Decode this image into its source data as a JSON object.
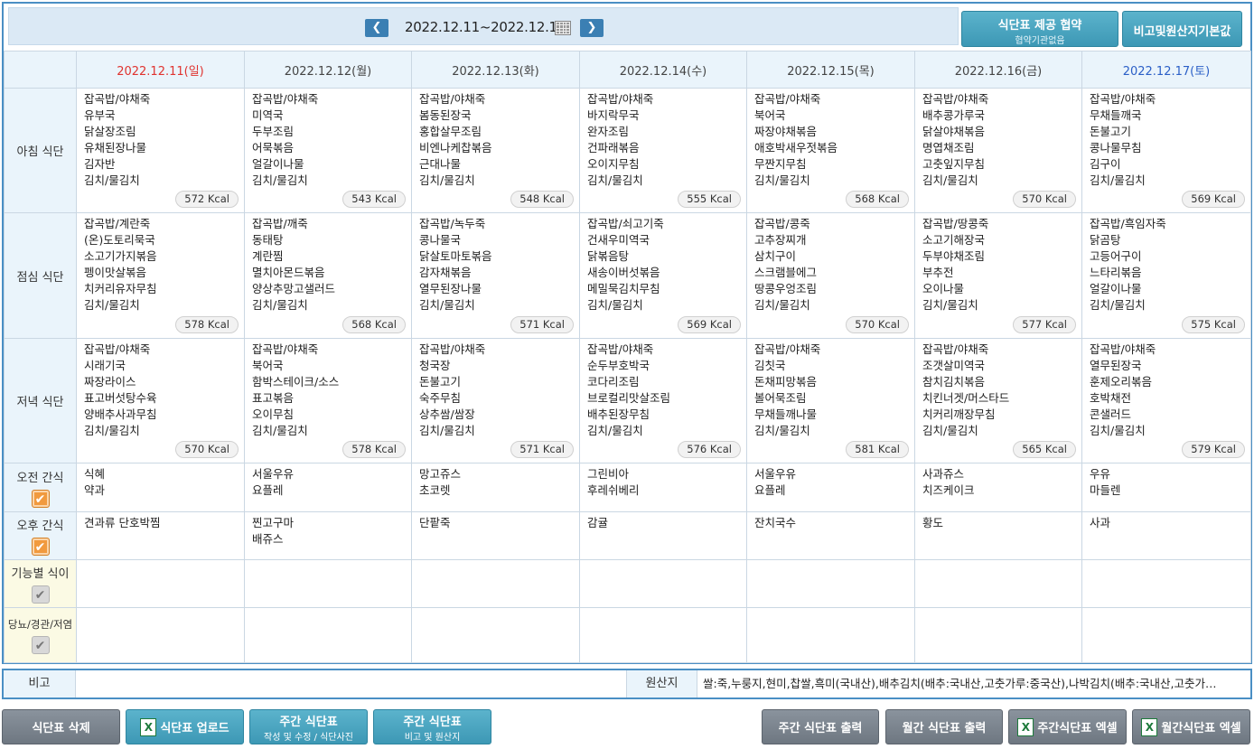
{
  "header": {
    "date_range": "2022.12.11~2022.12.17",
    "prev_icon": "chevron-left-icon",
    "next_icon": "chevron-right-icon",
    "provide_btn": {
      "main": "식단표 제공 협약",
      "sub": "협약기관없음"
    },
    "origin_default_btn": "비고및원산지기본값"
  },
  "days": [
    {
      "label": "2022.12.11(일)",
      "type": "sun"
    },
    {
      "label": "2022.12.12(월)",
      "type": ""
    },
    {
      "label": "2022.12.13(화)",
      "type": ""
    },
    {
      "label": "2022.12.14(수)",
      "type": ""
    },
    {
      "label": "2022.12.15(목)",
      "type": ""
    },
    {
      "label": "2022.12.16(금)",
      "type": ""
    },
    {
      "label": "2022.12.17(토)",
      "type": "sat"
    }
  ],
  "rows": [
    {
      "label": "아침 식단",
      "type": "meal",
      "cells": [
        {
          "items": [
            "잡곡밥/야채죽",
            "유부국",
            "닭살장조림",
            "유채된장나물",
            "김자반",
            "김치/물김치"
          ],
          "kcal": "572 Kcal"
        },
        {
          "items": [
            "잡곡밥/야채죽",
            "미역국",
            "두부조림",
            "어묵볶음",
            "얼갈이나물",
            "김치/물김치"
          ],
          "kcal": "543 Kcal"
        },
        {
          "items": [
            "잡곡밥/야채죽",
            "봄동된장국",
            "홍합살무조림",
            "비엔나케찹볶음",
            "근대나물",
            "김치/물김치"
          ],
          "kcal": "548 Kcal"
        },
        {
          "items": [
            "잡곡밥/야채죽",
            "바지락무국",
            "완자조림",
            "건파래볶음",
            "오이지무침",
            "김치/물김치"
          ],
          "kcal": "555 Kcal"
        },
        {
          "items": [
            "잡곡밥/야채죽",
            "북어국",
            "짜장야채볶음",
            "애호박새우젓볶음",
            "무짠지무침",
            "김치/물김치"
          ],
          "kcal": "568 Kcal"
        },
        {
          "items": [
            "잡곡밥/야채죽",
            "배추콩가루국",
            "닭살야채볶음",
            "명엽채조림",
            "고춧잎지무침",
            "김치/물김치"
          ],
          "kcal": "570 Kcal"
        },
        {
          "items": [
            "잡곡밥/야채죽",
            "무채들깨국",
            "돈불고기",
            "콩나물무침",
            "김구이",
            "김치/물김치"
          ],
          "kcal": "569 Kcal"
        }
      ]
    },
    {
      "label": "점심 식단",
      "type": "meal",
      "cells": [
        {
          "items": [
            "잡곡밥/계란죽",
            "(온)도토리묵국",
            "소고기가지볶음",
            "펭이맛살볶음",
            "치커리유자무침",
            "김치/물김치"
          ],
          "kcal": "578 Kcal"
        },
        {
          "items": [
            "잡곡밥/깨죽",
            "동태탕",
            "계란찜",
            "멸치아몬드볶음",
            "양상추망고샐러드",
            "김치/물김치"
          ],
          "kcal": "568 Kcal"
        },
        {
          "items": [
            "잡곡밥/녹두죽",
            "콩나물국",
            "닭살토마토볶음",
            "감자채볶음",
            "열무된장나물",
            "김치/물김치"
          ],
          "kcal": "571 Kcal"
        },
        {
          "items": [
            "잡곡밥/쇠고기죽",
            "건새우미역국",
            "닭볶음탕",
            "새송이버섯볶음",
            "메밀묵김치무침",
            "김치/물김치"
          ],
          "kcal": "569 Kcal"
        },
        {
          "items": [
            "잡곡밥/콩죽",
            "고추장찌개",
            "삼치구이",
            "스크램블에그",
            "땅콩우엉조림",
            "김치/물김치"
          ],
          "kcal": "570 Kcal"
        },
        {
          "items": [
            "잡곡밥/땅콩죽",
            "소고기해장국",
            "두부야채조림",
            "부추전",
            "오이나물",
            "김치/물김치"
          ],
          "kcal": "577 Kcal"
        },
        {
          "items": [
            "잡곡밥/흑임자죽",
            "닭곰탕",
            "고등어구이",
            "느타리볶음",
            "얼갈이나물",
            "김치/물김치"
          ],
          "kcal": "575 Kcal"
        }
      ]
    },
    {
      "label": "저녁 식단",
      "type": "meal",
      "cells": [
        {
          "items": [
            "잡곡밥/야채죽",
            "시래기국",
            "짜장라이스",
            "표고버섯탕수육",
            "양배추사과무침",
            "김치/물김치"
          ],
          "kcal": "570 Kcal"
        },
        {
          "items": [
            "잡곡밥/야채죽",
            "북어국",
            "함박스테이크/소스",
            "표고볶음",
            "오이무침",
            "김치/물김치"
          ],
          "kcal": "578 Kcal"
        },
        {
          "items": [
            "잡곡밥/야채죽",
            "청국장",
            "돈불고기",
            "숙주무침",
            "상추쌈/쌈장",
            "김치/물김치"
          ],
          "kcal": "571 Kcal"
        },
        {
          "items": [
            "잡곡밥/야채죽",
            "순두부호박국",
            "코다리조림",
            "브로컬리맛살조림",
            "배추된장무침",
            "김치/물김치"
          ],
          "kcal": "576 Kcal"
        },
        {
          "items": [
            "잡곡밥/야채죽",
            "김칫국",
            "돈채피망볶음",
            "볼어묵조림",
            "무채들깨나물",
            "김치/물김치"
          ],
          "kcal": "581 Kcal"
        },
        {
          "items": [
            "잡곡밥/야채죽",
            "조갯살미역국",
            "참치김치볶음",
            "치킨너겟/머스타드",
            "치커리깨장무침",
            "김치/물김치"
          ],
          "kcal": "565 Kcal"
        },
        {
          "items": [
            "잡곡밥/야채죽",
            "열무된장국",
            "훈제오리볶음",
            "호박채전",
            "콘샐러드",
            "김치/물김치"
          ],
          "kcal": "579 Kcal"
        }
      ]
    },
    {
      "label": "오전 간식",
      "type": "snack",
      "check": "on",
      "cells": [
        {
          "items": [
            "식혜",
            "약과"
          ]
        },
        {
          "items": [
            "서울우유",
            "요플레"
          ]
        },
        {
          "items": [
            "망고쥬스",
            "초코렛"
          ]
        },
        {
          "items": [
            "그린비아",
            "후레쉬베리"
          ]
        },
        {
          "items": [
            "서울우유",
            "요플레"
          ]
        },
        {
          "items": [
            "사과쥬스",
            "치즈케이크"
          ]
        },
        {
          "items": [
            "우유",
            "마들렌"
          ]
        }
      ]
    },
    {
      "label": "오후 간식",
      "type": "snack",
      "check": "on",
      "cells": [
        {
          "items": [
            "견과류 단호박찜"
          ]
        },
        {
          "items": [
            "찐고구마",
            "배쥬스"
          ]
        },
        {
          "items": [
            "단팥죽"
          ]
        },
        {
          "items": [
            "감귤"
          ]
        },
        {
          "items": [
            "잔치국수"
          ]
        },
        {
          "items": [
            "황도"
          ]
        },
        {
          "items": [
            "사과"
          ]
        }
      ]
    },
    {
      "label": "기능별 식이",
      "type": "special",
      "check": "off",
      "cells": [
        {
          "items": []
        },
        {
          "items": []
        },
        {
          "items": []
        },
        {
          "items": []
        },
        {
          "items": []
        },
        {
          "items": []
        },
        {
          "items": []
        }
      ]
    },
    {
      "label": "당뇨/경관/저염",
      "type": "special",
      "check": "off",
      "cells": [
        {
          "items": []
        },
        {
          "items": []
        },
        {
          "items": []
        },
        {
          "items": []
        },
        {
          "items": []
        },
        {
          "items": []
        },
        {
          "items": []
        }
      ]
    }
  ],
  "remark": {
    "label": "비고",
    "value": "",
    "origin_label": "원산지",
    "origin_value": "쌀:죽,누룽지,현미,찹쌀,흑미(국내산),배추김치(배추:국내산,고춧가루:중국산),나박김치(배추:국내산,고춧가…"
  },
  "buttons": {
    "delete": "식단표 삭제",
    "upload": "식단표 업로드",
    "weekly_edit": {
      "main": "주간 식단표",
      "sub": "작성 및 수정 / 식단사진"
    },
    "weekly_origin": {
      "main": "주간 식단표",
      "sub": "비고 및 원산지"
    },
    "weekly_print": "주간 식단표 출력",
    "monthly_print": "월간 식단표 출력",
    "weekly_excel": "주간식단표 엑셀",
    "monthly_excel": "월간식단표 엑셀"
  },
  "colors": {
    "sunday": "#e0332f",
    "saturday": "#2b5fc7",
    "accent": "#3d98b5",
    "frame": "#4a8fc4"
  }
}
